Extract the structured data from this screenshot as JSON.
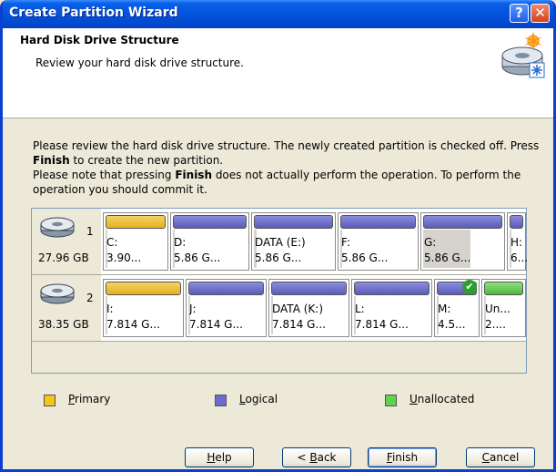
{
  "window": {
    "title": "Create Partition Wizard",
    "help_button": "?",
    "close_button": "✕"
  },
  "header": {
    "title": "Hard Disk Drive Structure",
    "subtitle": "Review your hard disk drive structure."
  },
  "description": {
    "line1": "Please review the hard disk drive structure. The newly created partition is checked off. Press ",
    "line1_bold": "Finish",
    "line1_end": " to create the new partition.",
    "line2": "Please note that pressing ",
    "line2_bold": "Finish",
    "line2_end": " does not actually perform the operation. To perform the operation you should commit it."
  },
  "disks": [
    {
      "number": "1",
      "size": "27.96 GB",
      "partitions": [
        {
          "type": "primary",
          "name": "C:",
          "size": "3.90...",
          "used": 0.03
        },
        {
          "type": "logical",
          "name": "D:",
          "size": "5.86 G...",
          "used": 0.02
        },
        {
          "type": "logical",
          "name": "DATA (E:)",
          "size": "5.86 G...",
          "used": 0.03
        },
        {
          "type": "logical",
          "name": "F:",
          "size": "5.86 G...",
          "used": 0.02
        },
        {
          "type": "logical",
          "name": "G:",
          "size": "5.86 G...",
          "used": 0.6
        },
        {
          "type": "logical",
          "name": "H:",
          "size": "6...",
          "used": 0.02
        }
      ]
    },
    {
      "number": "2",
      "size": "38.35 GB",
      "partitions": [
        {
          "type": "primary",
          "name": "I:",
          "size": "7.814 G...",
          "used": 0.02
        },
        {
          "type": "logical",
          "name": "J:",
          "size": "7.814 G...",
          "used": 0.02
        },
        {
          "type": "logical",
          "name": "DATA (K:)",
          "size": "7.814 G...",
          "used": 0.02
        },
        {
          "type": "logical",
          "name": "L:",
          "size": "7.814 G...",
          "used": 0.02
        },
        {
          "type": "logical",
          "name": "M:",
          "size": "4.5...",
          "used": 0.02,
          "checked": true
        },
        {
          "type": "unallocated",
          "name": "Un...",
          "size": "2....",
          "used": 0.02
        }
      ]
    }
  ],
  "legend": [
    {
      "label_u": "P",
      "label_rest": "rimary",
      "color": "#f5c518"
    },
    {
      "label_u": "L",
      "label_rest": "ogical",
      "color": "#6b6bd0"
    },
    {
      "label_u": "U",
      "label_rest": "nallocated",
      "color": "#5fd44a"
    }
  ],
  "buttons": {
    "help": {
      "u": "H",
      "rest": "elp"
    },
    "back": {
      "pre": "< ",
      "u": "B",
      "rest": "ack"
    },
    "finish": {
      "u": "F",
      "rest": "inish"
    },
    "cancel": {
      "u": "C",
      "rest": "ancel"
    }
  },
  "colors": {
    "titlebar": "#0453dc",
    "primary": "#e3b21c",
    "logical": "#5b5cb8",
    "unallocated": "#4fb83c"
  }
}
